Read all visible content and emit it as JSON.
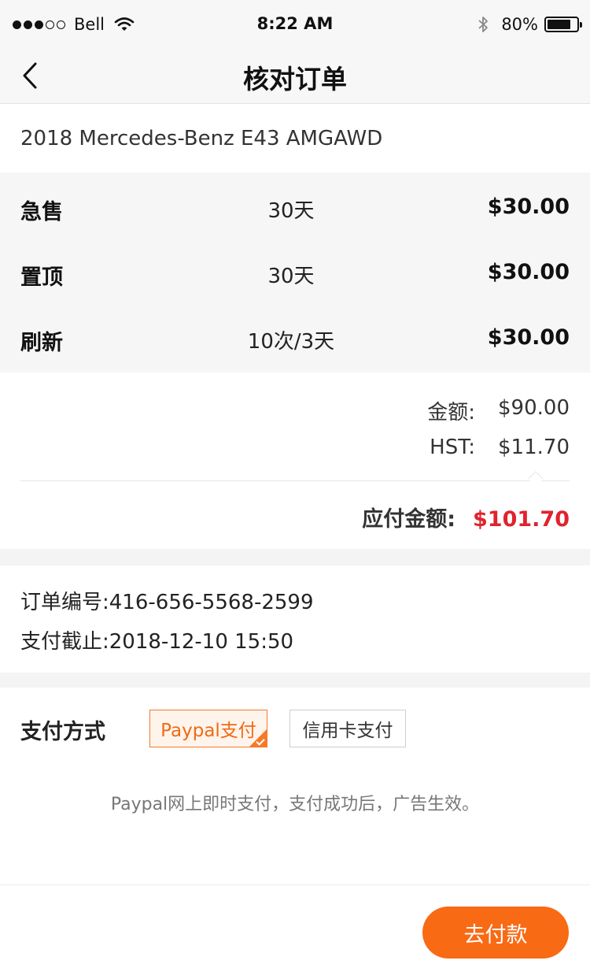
{
  "status_bar": {
    "carrier": "Bell",
    "signal_filled": 3,
    "signal_total": 5,
    "time": "8:22 AM",
    "battery": "80%",
    "battery_level": 0.8,
    "icons": [
      "signal-dots-icon",
      "wifi-icon",
      "bluetooth-icon",
      "battery-icon"
    ]
  },
  "nav": {
    "title": "核对订单",
    "back_icon": "chevron-left-icon"
  },
  "vehicle": {
    "name": "2018 Mercedes-Benz E43 AMGAWD"
  },
  "items": [
    {
      "name": "急售",
      "duration": "30天",
      "price": "$30.00"
    },
    {
      "name": "置顶",
      "duration": "30天",
      "price": "$30.00"
    },
    {
      "name": "刷新",
      "duration": "10次/3天",
      "price": "$30.00"
    }
  ],
  "totals": {
    "amount_label": "金额:",
    "amount": "$90.00",
    "tax_label": "HST:",
    "tax": "$11.70",
    "due_label": "应付金额:",
    "due": "$101.70"
  },
  "order": {
    "number_label": "订单编号:",
    "number": "416-656-5568-2599",
    "deadline_label": "支付截止:",
    "deadline": "2018-12-10 15:50"
  },
  "payment": {
    "label": "支付方式",
    "options": [
      {
        "label": "Paypal支付",
        "selected": true
      },
      {
        "label": "信用卡支付",
        "selected": false
      }
    ],
    "note": "Paypal网上即时支付，支付成功后，广告生效。"
  },
  "actions": {
    "pay_button": "去付款"
  },
  "colors": {
    "accent": "#f96a14",
    "due_red": "#e0232d",
    "selected_border": "#f47a2a"
  }
}
